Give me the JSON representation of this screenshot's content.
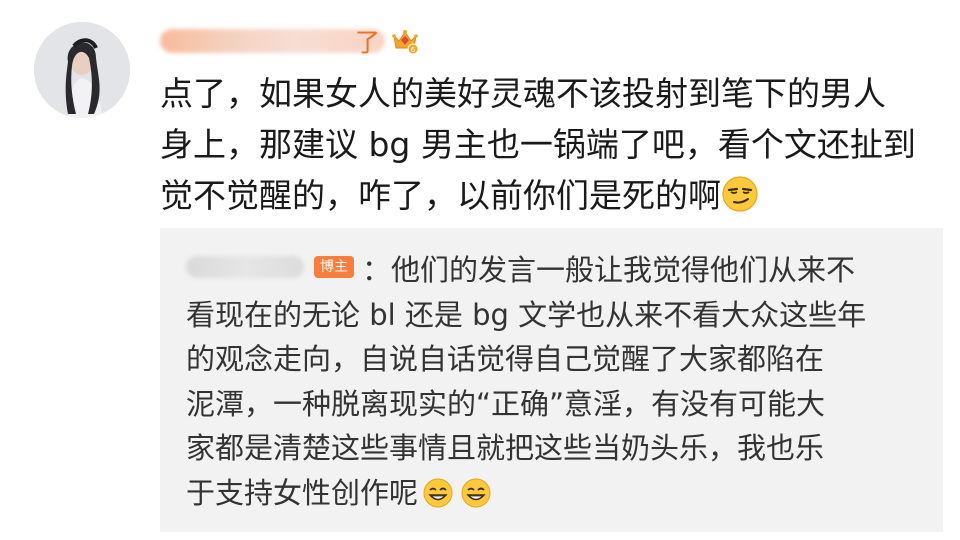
{
  "comment": {
    "author_name_visible_tail": "了",
    "author_badge_icon": "crown-level-icon",
    "lines": [
      "点了，如果女人的美好灵魂不该投射到笔下的男人",
      "身上，那建议 bg 男主也一锅端了吧，看个文还扯到",
      "觉不觉醒的，咋了，以前你们是死的啊"
    ],
    "trailing_emoji": "smirk-emoji"
  },
  "reply": {
    "author_badge": "博主",
    "separator": "：",
    "lines": [
      "他们的发言一般让我觉得他们从来不",
      "看现在的无论 bl 还是 bg 文学也从来不看大众这些年",
      "的观念走向，自说自话觉得自己觉醒了大家都陷在",
      "泥潭，一种脱离现实的“正确”意淫，有没有可能大",
      "家都是清楚这些事情且就把这些当奶头乐，我也乐",
      "于支持女性创作呢"
    ],
    "trailing_emojis": [
      "grin-emoji",
      "grin-emoji"
    ]
  },
  "colors": {
    "name_orange": "#eb6f2b",
    "badge_orange": "#fa7d3c",
    "reply_bg": "#f2f2f2",
    "text_main": "#1a1a1a",
    "text_reply": "#333333"
  }
}
